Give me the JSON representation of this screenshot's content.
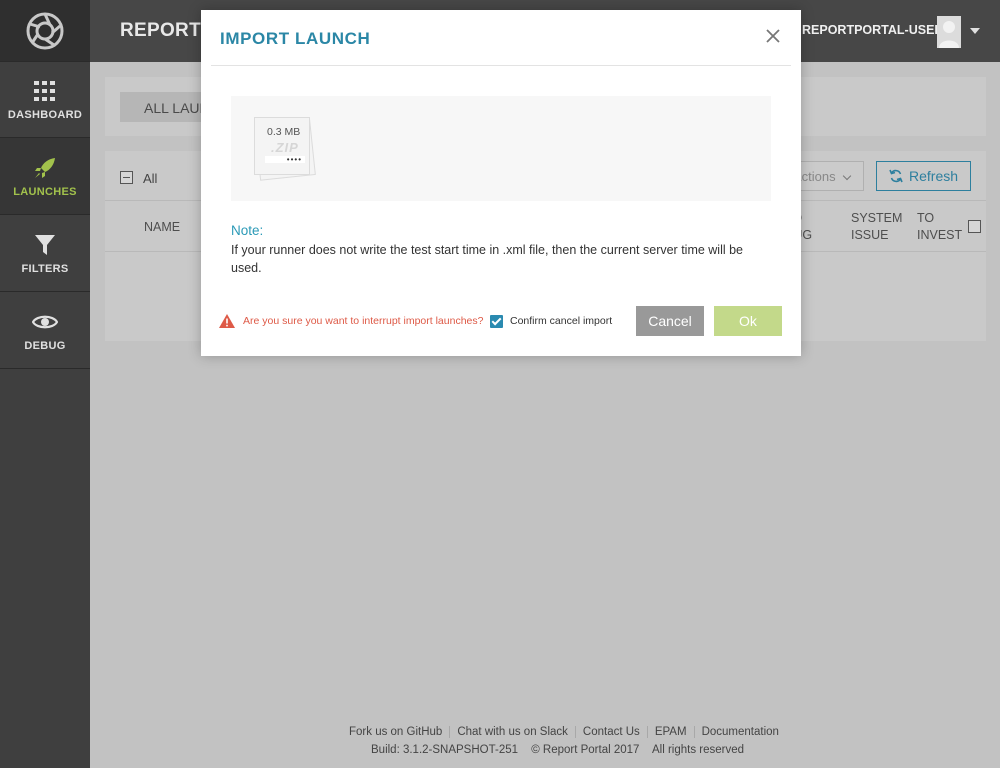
{
  "app": {
    "project_name": "REPORTPORTAL",
    "user_name": "REPORTPORTAL-USER"
  },
  "sidebar": {
    "items": [
      {
        "label": "DASHBOARD",
        "icon": "grid-icon",
        "active": false
      },
      {
        "label": "LAUNCHES",
        "icon": "rocket-icon",
        "active": true
      },
      {
        "label": "FILTERS",
        "icon": "funnel-icon",
        "active": false
      },
      {
        "label": "DEBUG",
        "icon": "eye-icon",
        "active": false
      }
    ]
  },
  "launches": {
    "tab_label": "ALL LAUNCHES",
    "select_all_label": "All",
    "actions_label": "Actions",
    "refresh_label": "Refresh",
    "columns": [
      "NAME",
      "TO BUG",
      "SYSTEM ISSUE",
      "TO INVEST"
    ]
  },
  "modal": {
    "title": "IMPORT LAUNCH",
    "file": {
      "size": "0.3 MB",
      "extension": ".ZIP",
      "progress": "••••"
    },
    "note_title": "Note:",
    "note_text": "If your runner does not write the test start time in .xml file, then the current server time will be used.",
    "warning_text": "Are you sure you want to interrupt import launches?",
    "confirm_label": "Confirm cancel import",
    "confirm_checked": true,
    "cancel_label": "Cancel",
    "ok_label": "Ok"
  },
  "footer": {
    "links": [
      "Fork us on GitHub",
      "Chat with us on Slack",
      "Contact Us",
      "EPAM",
      "Documentation"
    ],
    "build": "Build: 3.1.2-SNAPSHOT-251",
    "copyright": "© Report Portal  2017",
    "rights": "All rights reserved"
  },
  "colors": {
    "accent": "#2b87a6",
    "active_nav": "#a2c24c",
    "warning": "#de5a47",
    "ok_button": "#c3d98a",
    "cancel_button": "#999999"
  }
}
